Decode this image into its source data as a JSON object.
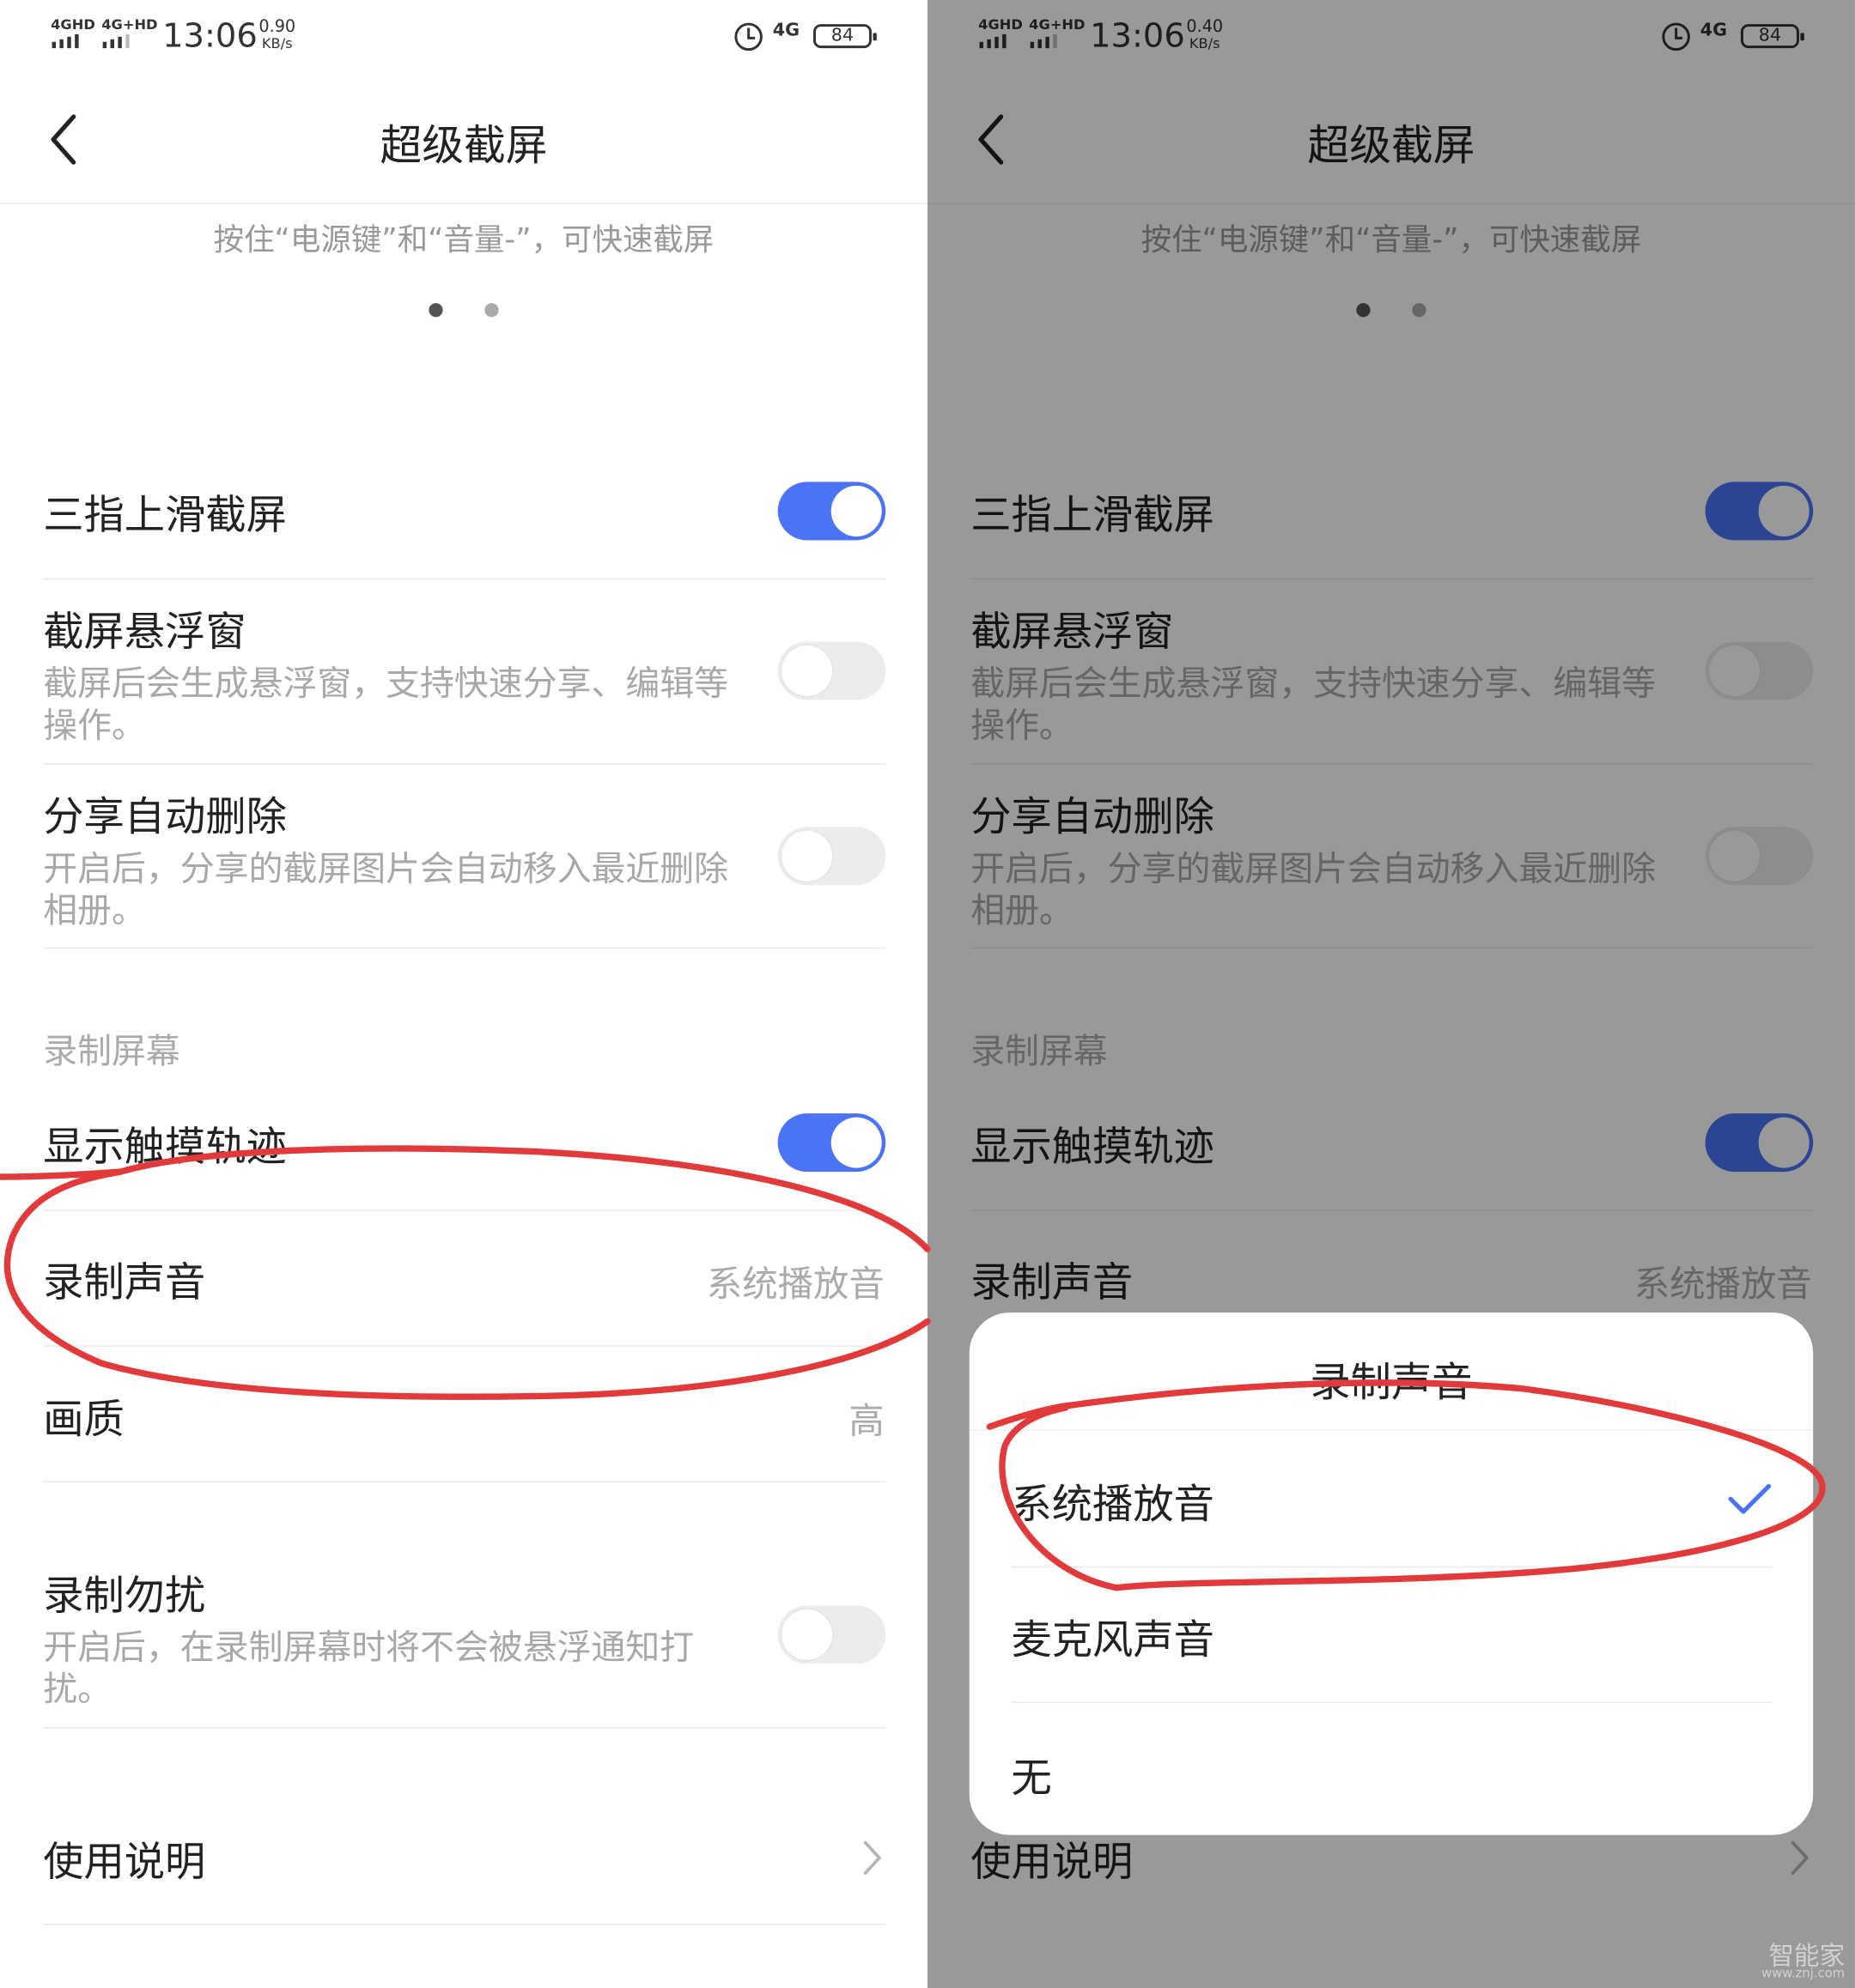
{
  "status_bar": {
    "left": {
      "sig1": "4GHD",
      "sig2": "4G+HD",
      "time": "13:06",
      "speed_value": "0.90",
      "speed_unit": "KB/s"
    },
    "right": {
      "sig1": "4GHD",
      "sig2": "4G+HD",
      "time": "13:06",
      "speed_value": "0.40",
      "speed_unit": "KB/s"
    },
    "network": "4G",
    "battery": "84"
  },
  "header": {
    "title": "超级截屏",
    "back_icon": "chevron-left-icon"
  },
  "hint": "按住“电源键”和“音量-”，可快速截屏",
  "pager": {
    "count": 2,
    "active": 0
  },
  "settings": {
    "three_finger": {
      "title": "三指上滑截屏",
      "enabled": true
    },
    "float_window": {
      "title": "截屏悬浮窗",
      "desc": "截屏后会生成悬浮窗，支持快速分享、编辑等操作。",
      "enabled": false
    },
    "share_delete": {
      "title": "分享自动删除",
      "desc": "开启后，分享的截屏图片会自动移入最近删除相册。",
      "enabled": false
    },
    "record_section": "录制屏幕",
    "touch_trace": {
      "title": "显示触摸轨迹",
      "enabled": true
    },
    "record_sound": {
      "title": "录制声音",
      "value": "系统播放音"
    },
    "quality": {
      "title": "画质",
      "value": "高"
    },
    "dnd": {
      "title": "录制勿扰",
      "desc": "开启后，在录制屏幕时将不会被悬浮通知打扰。",
      "enabled": false
    },
    "manual": {
      "title": "使用说明"
    }
  },
  "dialog": {
    "title": "录制声音",
    "options": [
      "系统播放音",
      "麦克风声音",
      "无"
    ],
    "selected": 0
  },
  "colors": {
    "accent": "#4a73f5",
    "annotation": "#e23a3a"
  },
  "watermark": {
    "main": "智能家",
    "sub": "www.znj.com"
  }
}
